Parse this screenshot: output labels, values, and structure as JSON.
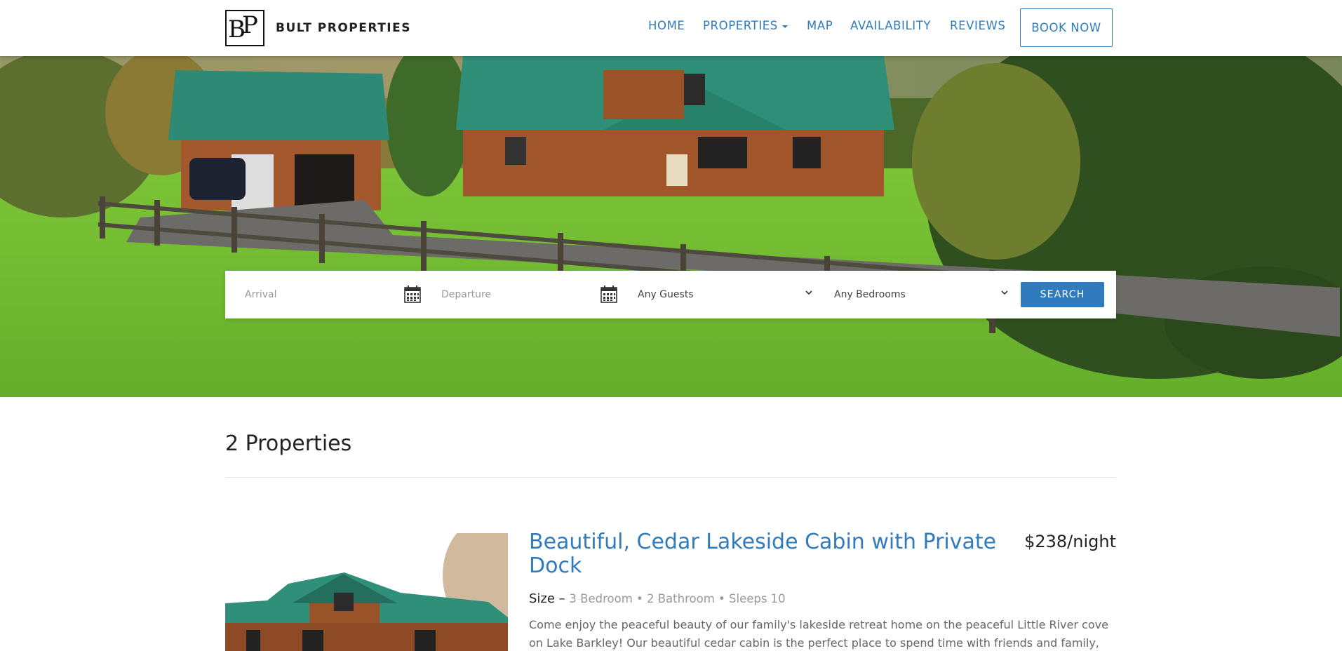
{
  "brand": {
    "logo_text": "BP",
    "name": "BULT PROPERTIES"
  },
  "nav": {
    "items": [
      {
        "label": "HOME"
      },
      {
        "label": "PROPERTIES"
      },
      {
        "label": "MAP"
      },
      {
        "label": "AVAILABILITY"
      },
      {
        "label": "REVIEWS"
      }
    ],
    "book_now": "BOOK NOW"
  },
  "search": {
    "arrival_placeholder": "Arrival",
    "departure_placeholder": "Departure",
    "guests_selected": "Any Guests",
    "bedrooms_selected": "Any Bedrooms",
    "button_label": "SEARCH"
  },
  "results": {
    "count_title": "2 Properties"
  },
  "listing": {
    "title": "Beautiful, Cedar Lakeside Cabin with Private Dock",
    "price": "$238/night",
    "size_label": "Size –",
    "size_value": "3 Bedroom • 2 Bathroom • Sleeps 10",
    "description": "Come enjoy the peaceful beauty of our family's lakeside retreat home on the peaceful Little River cove on Lake Barkley! Our beautiful cedar cabin is the perfect place to spend time with friends and family,"
  },
  "icons": [
    "calendar-icon",
    "chevron-down-icon",
    "caret-down-icon"
  ],
  "colors": {
    "accent": "#2f7bbd",
    "text": "#222222",
    "muted": "#999999"
  }
}
